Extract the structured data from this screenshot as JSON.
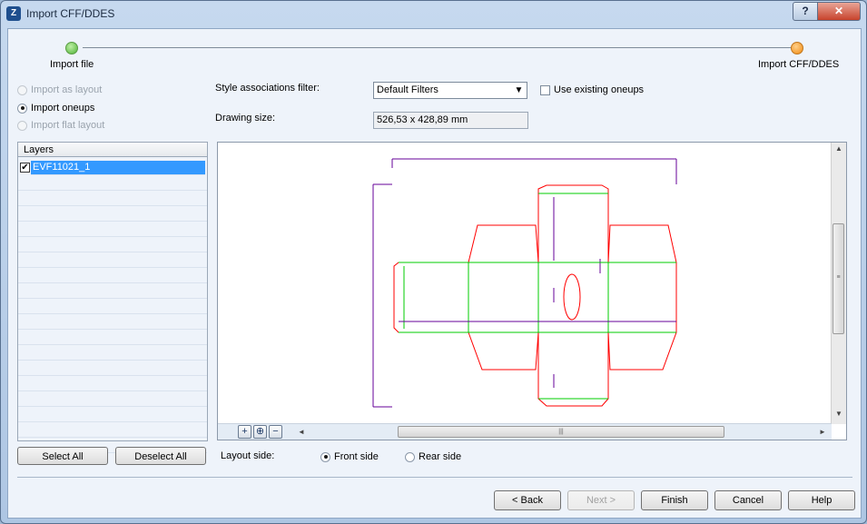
{
  "window": {
    "title": "Import CFF/DDES",
    "help_label": "?",
    "close_label": "✕",
    "app_icon_glyph": "Z"
  },
  "steps": {
    "first_label": "Import file",
    "last_label": "Import CFF/DDES"
  },
  "import_mode": {
    "options": [
      {
        "label": "Import as layout",
        "selected": false,
        "disabled": true
      },
      {
        "label": "Import oneups",
        "selected": true,
        "disabled": false
      },
      {
        "label": "Import flat layout",
        "selected": false,
        "disabled": true
      }
    ]
  },
  "style_filter": {
    "label": "Style associations filter:",
    "value": "Default Filters",
    "arrow": "▼"
  },
  "use_existing": {
    "label": "Use existing oneups",
    "checked": false
  },
  "drawing_size": {
    "label": "Drawing size:",
    "value": "526,53 x 428,89 mm"
  },
  "layers": {
    "header": "Layers",
    "items": [
      {
        "name": "EVF11021_1",
        "checked": true,
        "selected": true
      }
    ],
    "check_glyph": "✔"
  },
  "layer_buttons": {
    "select_all": "Select All",
    "deselect_all": "Deselect All"
  },
  "layout_side": {
    "label": "Layout side:",
    "front": "Front side",
    "rear": "Rear side",
    "selected": "front"
  },
  "preview": {
    "zoom_in": "+",
    "zoom_fit": "⊕",
    "zoom_out": "−",
    "grip": "|||",
    "vgrip": "≡",
    "up": "▲",
    "down": "▼",
    "left": "◄",
    "right": "►"
  },
  "dialog_buttons": {
    "back": "< Back",
    "next": "Next >",
    "finish": "Finish",
    "cancel": "Cancel",
    "help": "Help"
  },
  "colors": {
    "cut_line": "#ff0000",
    "crease_line": "#00cc00",
    "dimension_line": "#660099"
  }
}
